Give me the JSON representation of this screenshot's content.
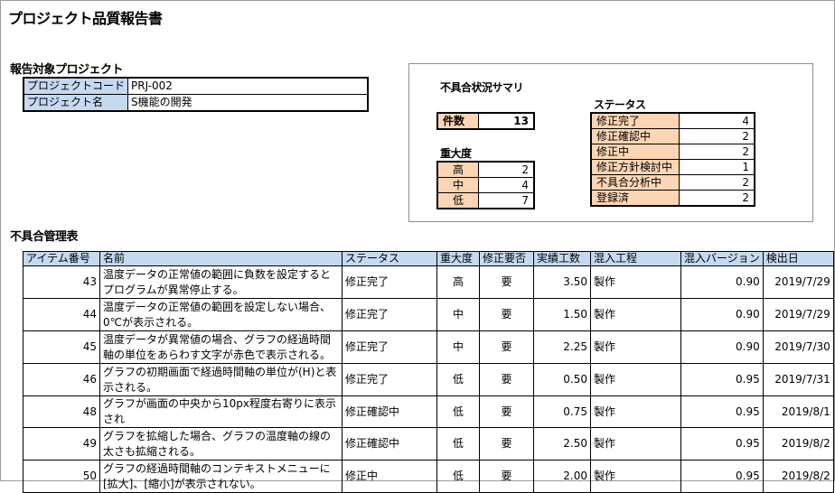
{
  "title": "プロジェクト品質報告書",
  "project_section": {
    "label": "報告対象プロジェクト",
    "rows": [
      {
        "key": "プロジェクトコード",
        "value": "PRJ-002"
      },
      {
        "key": "プロジェクト名",
        "value": "S機能の開発"
      }
    ]
  },
  "summary": {
    "title": "不具合状況サマリ",
    "count_label": "件数",
    "count_value": "13",
    "severity_label": "重大度",
    "severity": [
      {
        "label": "高",
        "value": "2"
      },
      {
        "label": "中",
        "value": "4"
      },
      {
        "label": "低",
        "value": "7"
      }
    ],
    "status_label": "ステータス",
    "status": [
      {
        "label": "修正完了",
        "value": "4"
      },
      {
        "label": "修正確認中",
        "value": "2"
      },
      {
        "label": "修正中",
        "value": "2"
      },
      {
        "label": "修正方針検討中",
        "value": "1"
      },
      {
        "label": "不具合分析中",
        "value": "2"
      },
      {
        "label": "登録済",
        "value": "2"
      }
    ]
  },
  "defects": {
    "label": "不具合管理表",
    "headers": [
      "アイテム番号",
      "名前",
      "ステータス",
      "重大度",
      "修正要否",
      "実績工数",
      "混入工程",
      "混入バージョン",
      "検出日"
    ],
    "rows": [
      {
        "id": "43",
        "name": "温度データの正常値の範囲に負数を設定するとプログラムが異常停止する。",
        "status": "修正完了",
        "severity": "高",
        "required": "要",
        "effort": "3.50",
        "phase": "製作",
        "version": "0.90",
        "date": "2019/7/29"
      },
      {
        "id": "44",
        "name": "温度データの正常値の範囲を設定しない場合、0℃が表示される。",
        "status": "修正完了",
        "severity": "中",
        "required": "要",
        "effort": "1.50",
        "phase": "製作",
        "version": "0.90",
        "date": "2019/7/29"
      },
      {
        "id": "45",
        "name": "温度データが異常値の場合、グラフの経過時間軸の単位をあらわす文字が赤色で表示される。",
        "status": "修正完了",
        "severity": "中",
        "required": "要",
        "effort": "2.25",
        "phase": "製作",
        "version": "0.90",
        "date": "2019/7/30"
      },
      {
        "id": "46",
        "name": "グラフの初期画面で経過時間軸の単位が(H)と表示される。",
        "status": "修正完了",
        "severity": "低",
        "required": "要",
        "effort": "0.50",
        "phase": "製作",
        "version": "0.95",
        "date": "2019/7/31"
      },
      {
        "id": "48",
        "name": "グラフが画面の中央から10px程度右寄りに表示され",
        "status": "修正確認中",
        "severity": "低",
        "required": "要",
        "effort": "0.75",
        "phase": "製作",
        "version": "0.95",
        "date": "2019/8/1"
      },
      {
        "id": "49",
        "name": "グラフを拡縮した場合、グラフの温度軸の線の太さも拡縮される。",
        "status": "修正確認中",
        "severity": "低",
        "required": "要",
        "effort": "2.50",
        "phase": "製作",
        "version": "0.95",
        "date": "2019/8/2"
      },
      {
        "id": "50",
        "name": "グラフの経過時間軸のコンテキストメニューに[拡大]、[縮小]が表示されない。",
        "status": "修正中",
        "severity": "低",
        "required": "要",
        "effort": "2.00",
        "phase": "製作",
        "version": "0.95",
        "date": "2019/8/2"
      }
    ]
  }
}
